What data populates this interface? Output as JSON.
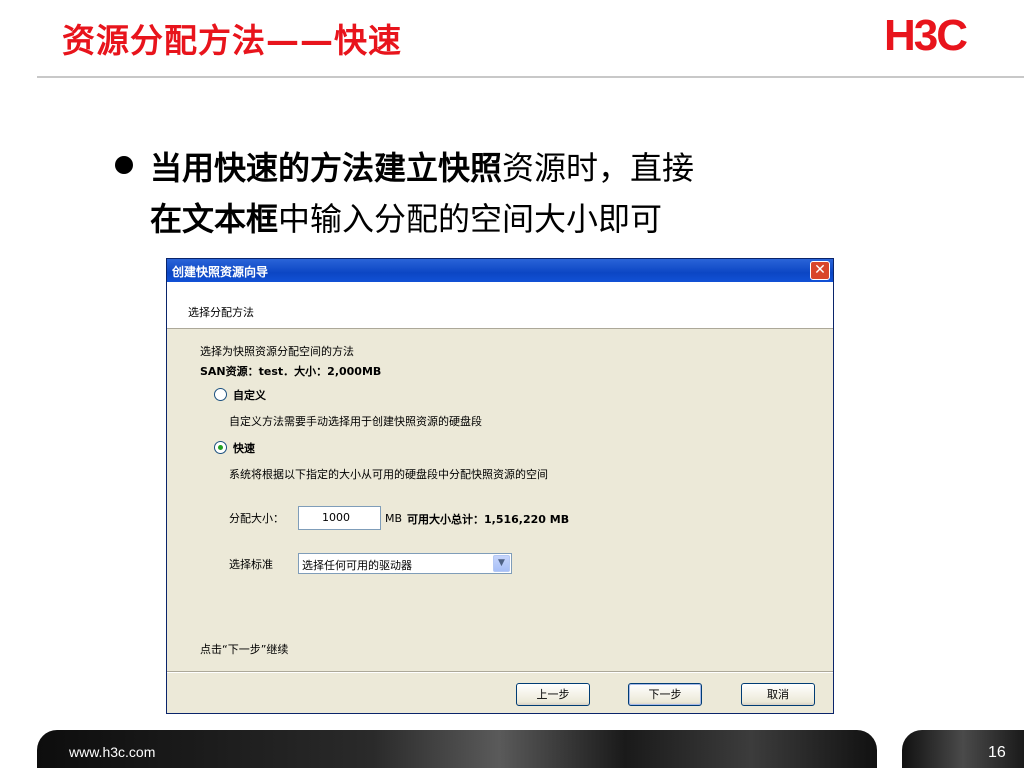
{
  "slide": {
    "title": "资源分配方法——快速",
    "logo": "H3C",
    "bullet_bold": "当用快速的方法建立快照",
    "bullet_rest_line1": "资源时，直接",
    "bullet_bold2": "在文本框",
    "bullet_rest_line2": "中输入分配的空间大小即可",
    "footer_url": "www.h3c.com",
    "page_number": "16"
  },
  "dialog": {
    "title": "创建快照资源向导",
    "close_label": "✕",
    "header": "选择分配方法",
    "intro": "选择为快照资源分配空间的方法",
    "san_info": "SAN资源：test．大小：2,000MB",
    "option_custom": "自定义",
    "custom_desc": "自定义方法需要手动选择用于创建快照资源的硬盘段",
    "option_fast": "快速",
    "fast_desc": "系统将根据以下指定的大小从可用的硬盘段中分配快照资源的空间",
    "size_label": "分配大小：",
    "size_value": "1000",
    "size_unit": "MB",
    "available_total": "可用大小总计：1,516,220 MB",
    "criteria_label": "选择标准",
    "criteria_value": "选择任何可用的驱动器",
    "hint": "点击“下一步”继续",
    "btn_prev": "上一步",
    "btn_next": "下一步",
    "btn_cancel": "取消",
    "selected_option": "快速"
  },
  "colors": {
    "title_red": "#e8141c",
    "titlebar_blue": "#0c46c4",
    "dialog_bg": "#ece9d8"
  }
}
